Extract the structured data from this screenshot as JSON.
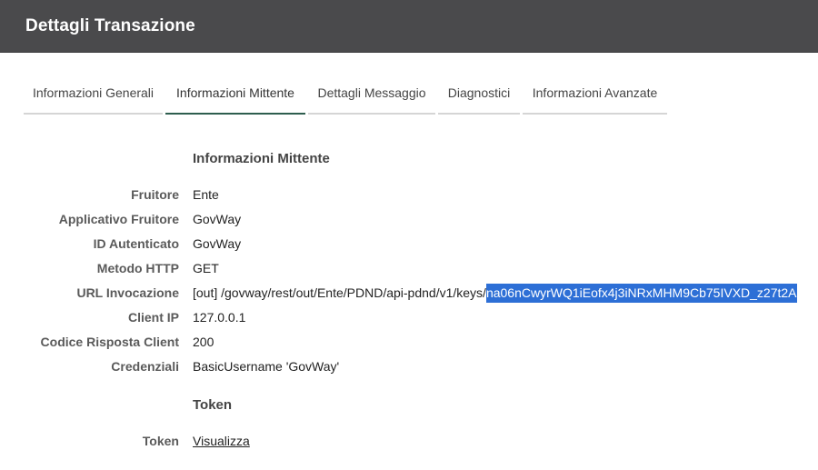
{
  "header": {
    "title": "Dettagli Transazione"
  },
  "tabs": [
    {
      "label": "Informazioni Generali"
    },
    {
      "label": "Informazioni Mittente"
    },
    {
      "label": "Dettagli Messaggio"
    },
    {
      "label": "Diagnostici"
    },
    {
      "label": "Informazioni Avanzate"
    }
  ],
  "sections": {
    "mittente_title": "Informazioni Mittente",
    "token_title": "Token"
  },
  "fields": {
    "fruitore": {
      "label": "Fruitore",
      "value": "Ente"
    },
    "applicativo": {
      "label": "Applicativo Fruitore",
      "value": "GovWay"
    },
    "id_autenticato": {
      "label": "ID Autenticato",
      "value": "GovWay"
    },
    "metodo": {
      "label": "Metodo HTTP",
      "value": "GET"
    },
    "url": {
      "label": "URL Invocazione",
      "value_prefix": "[out] /govway/rest/out/Ente/PDND/api-pdnd/v1/keys/",
      "value_selected": "na06nCwyrWQ1iEofx4j3iNRxMHM9Cb75IVXD_z27t2A"
    },
    "client_ip": {
      "label": "Client IP",
      "value": "127.0.0.1"
    },
    "codice_risposta": {
      "label": "Codice Risposta Client",
      "value": "200"
    },
    "credenziali": {
      "label": "Credenziali",
      "value": "BasicUsername 'GovWay'"
    },
    "token": {
      "label": "Token",
      "link": "Visualizza"
    }
  }
}
